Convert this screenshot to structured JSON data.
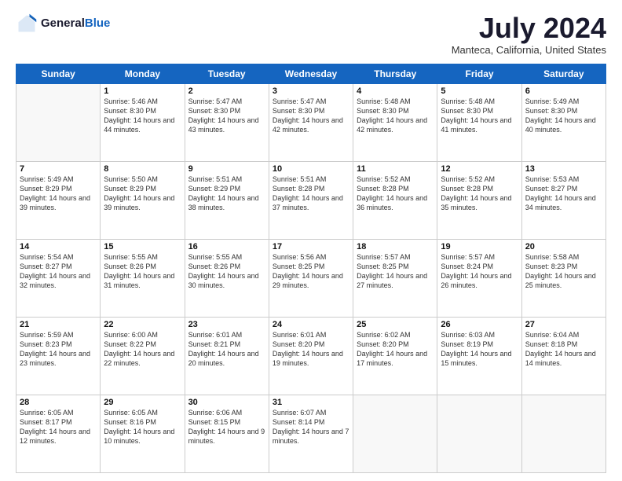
{
  "logo": {
    "general": "General",
    "blue": "Blue"
  },
  "header": {
    "month": "July 2024",
    "location": "Manteca, California, United States"
  },
  "days": [
    "Sunday",
    "Monday",
    "Tuesday",
    "Wednesday",
    "Thursday",
    "Friday",
    "Saturday"
  ],
  "weeks": [
    [
      {
        "day": "",
        "empty": true
      },
      {
        "day": "1",
        "sunrise": "Sunrise: 5:46 AM",
        "sunset": "Sunset: 8:30 PM",
        "daylight": "Daylight: 14 hours and 44 minutes."
      },
      {
        "day": "2",
        "sunrise": "Sunrise: 5:47 AM",
        "sunset": "Sunset: 8:30 PM",
        "daylight": "Daylight: 14 hours and 43 minutes."
      },
      {
        "day": "3",
        "sunrise": "Sunrise: 5:47 AM",
        "sunset": "Sunset: 8:30 PM",
        "daylight": "Daylight: 14 hours and 42 minutes."
      },
      {
        "day": "4",
        "sunrise": "Sunrise: 5:48 AM",
        "sunset": "Sunset: 8:30 PM",
        "daylight": "Daylight: 14 hours and 42 minutes."
      },
      {
        "day": "5",
        "sunrise": "Sunrise: 5:48 AM",
        "sunset": "Sunset: 8:30 PM",
        "daylight": "Daylight: 14 hours and 41 minutes."
      },
      {
        "day": "6",
        "sunrise": "Sunrise: 5:49 AM",
        "sunset": "Sunset: 8:30 PM",
        "daylight": "Daylight: 14 hours and 40 minutes."
      }
    ],
    [
      {
        "day": "7",
        "sunrise": "Sunrise: 5:49 AM",
        "sunset": "Sunset: 8:29 PM",
        "daylight": "Daylight: 14 hours and 39 minutes."
      },
      {
        "day": "8",
        "sunrise": "Sunrise: 5:50 AM",
        "sunset": "Sunset: 8:29 PM",
        "daylight": "Daylight: 14 hours and 39 minutes."
      },
      {
        "day": "9",
        "sunrise": "Sunrise: 5:51 AM",
        "sunset": "Sunset: 8:29 PM",
        "daylight": "Daylight: 14 hours and 38 minutes."
      },
      {
        "day": "10",
        "sunrise": "Sunrise: 5:51 AM",
        "sunset": "Sunset: 8:28 PM",
        "daylight": "Daylight: 14 hours and 37 minutes."
      },
      {
        "day": "11",
        "sunrise": "Sunrise: 5:52 AM",
        "sunset": "Sunset: 8:28 PM",
        "daylight": "Daylight: 14 hours and 36 minutes."
      },
      {
        "day": "12",
        "sunrise": "Sunrise: 5:52 AM",
        "sunset": "Sunset: 8:28 PM",
        "daylight": "Daylight: 14 hours and 35 minutes."
      },
      {
        "day": "13",
        "sunrise": "Sunrise: 5:53 AM",
        "sunset": "Sunset: 8:27 PM",
        "daylight": "Daylight: 14 hours and 34 minutes."
      }
    ],
    [
      {
        "day": "14",
        "sunrise": "Sunrise: 5:54 AM",
        "sunset": "Sunset: 8:27 PM",
        "daylight": "Daylight: 14 hours and 32 minutes."
      },
      {
        "day": "15",
        "sunrise": "Sunrise: 5:55 AM",
        "sunset": "Sunset: 8:26 PM",
        "daylight": "Daylight: 14 hours and 31 minutes."
      },
      {
        "day": "16",
        "sunrise": "Sunrise: 5:55 AM",
        "sunset": "Sunset: 8:26 PM",
        "daylight": "Daylight: 14 hours and 30 minutes."
      },
      {
        "day": "17",
        "sunrise": "Sunrise: 5:56 AM",
        "sunset": "Sunset: 8:25 PM",
        "daylight": "Daylight: 14 hours and 29 minutes."
      },
      {
        "day": "18",
        "sunrise": "Sunrise: 5:57 AM",
        "sunset": "Sunset: 8:25 PM",
        "daylight": "Daylight: 14 hours and 27 minutes."
      },
      {
        "day": "19",
        "sunrise": "Sunrise: 5:57 AM",
        "sunset": "Sunset: 8:24 PM",
        "daylight": "Daylight: 14 hours and 26 minutes."
      },
      {
        "day": "20",
        "sunrise": "Sunrise: 5:58 AM",
        "sunset": "Sunset: 8:23 PM",
        "daylight": "Daylight: 14 hours and 25 minutes."
      }
    ],
    [
      {
        "day": "21",
        "sunrise": "Sunrise: 5:59 AM",
        "sunset": "Sunset: 8:23 PM",
        "daylight": "Daylight: 14 hours and 23 minutes."
      },
      {
        "day": "22",
        "sunrise": "Sunrise: 6:00 AM",
        "sunset": "Sunset: 8:22 PM",
        "daylight": "Daylight: 14 hours and 22 minutes."
      },
      {
        "day": "23",
        "sunrise": "Sunrise: 6:01 AM",
        "sunset": "Sunset: 8:21 PM",
        "daylight": "Daylight: 14 hours and 20 minutes."
      },
      {
        "day": "24",
        "sunrise": "Sunrise: 6:01 AM",
        "sunset": "Sunset: 8:20 PM",
        "daylight": "Daylight: 14 hours and 19 minutes."
      },
      {
        "day": "25",
        "sunrise": "Sunrise: 6:02 AM",
        "sunset": "Sunset: 8:20 PM",
        "daylight": "Daylight: 14 hours and 17 minutes."
      },
      {
        "day": "26",
        "sunrise": "Sunrise: 6:03 AM",
        "sunset": "Sunset: 8:19 PM",
        "daylight": "Daylight: 14 hours and 15 minutes."
      },
      {
        "day": "27",
        "sunrise": "Sunrise: 6:04 AM",
        "sunset": "Sunset: 8:18 PM",
        "daylight": "Daylight: 14 hours and 14 minutes."
      }
    ],
    [
      {
        "day": "28",
        "sunrise": "Sunrise: 6:05 AM",
        "sunset": "Sunset: 8:17 PM",
        "daylight": "Daylight: 14 hours and 12 minutes."
      },
      {
        "day": "29",
        "sunrise": "Sunrise: 6:05 AM",
        "sunset": "Sunset: 8:16 PM",
        "daylight": "Daylight: 14 hours and 10 minutes."
      },
      {
        "day": "30",
        "sunrise": "Sunrise: 6:06 AM",
        "sunset": "Sunset: 8:15 PM",
        "daylight": "Daylight: 14 hours and 9 minutes."
      },
      {
        "day": "31",
        "sunrise": "Sunrise: 6:07 AM",
        "sunset": "Sunset: 8:14 PM",
        "daylight": "Daylight: 14 hours and 7 minutes."
      },
      {
        "day": "",
        "empty": true
      },
      {
        "day": "",
        "empty": true
      },
      {
        "day": "",
        "empty": true
      }
    ]
  ]
}
